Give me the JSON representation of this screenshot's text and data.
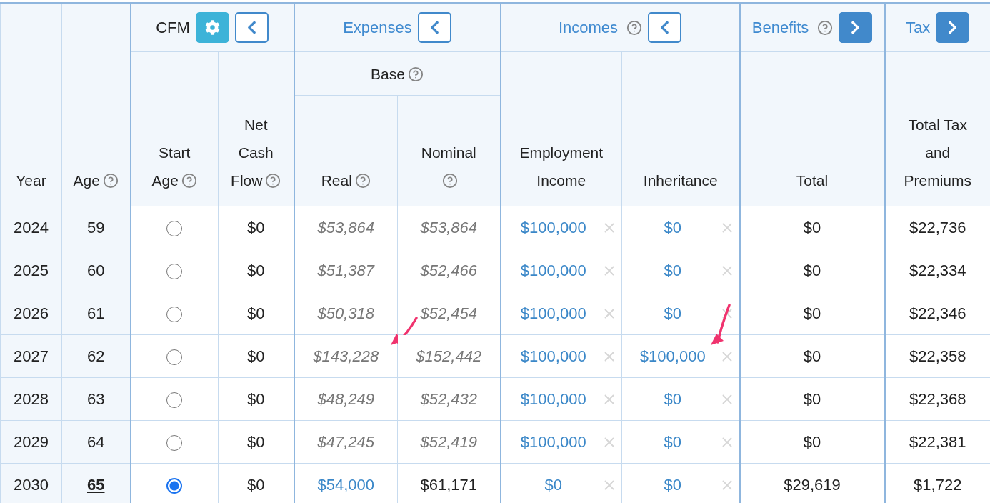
{
  "header": {
    "top": [
      {
        "label": "Year",
        "help": false,
        "link": false
      },
      {
        "label": "Age",
        "help": true,
        "link": false
      },
      {
        "label": "CFM",
        "help": false,
        "link": false,
        "buttons": [
          {
            "kind": "settings"
          },
          {
            "kind": "collapse"
          }
        ]
      },
      {
        "label": "Expenses",
        "help": false,
        "link": true,
        "buttons": [
          {
            "kind": "collapse"
          }
        ]
      },
      {
        "label": "Incomes",
        "help": true,
        "link": true,
        "buttons": [
          {
            "kind": "collapse"
          }
        ]
      },
      {
        "label": "Benefits",
        "help": true,
        "link": true,
        "buttons": [
          {
            "kind": "expand"
          }
        ]
      },
      {
        "label": "Tax",
        "help": false,
        "link": true,
        "buttons": [
          {
            "kind": "expand"
          }
        ]
      }
    ],
    "subgroup": {
      "label": "Base",
      "help": true
    },
    "columns": [
      {
        "label": "Start Age",
        "help": true
      },
      {
        "label": "Net Cash Flow",
        "help": true
      },
      {
        "label": "Real",
        "help": true
      },
      {
        "label": "Nominal",
        "help": true
      },
      {
        "label": "Employment Income",
        "help": false
      },
      {
        "label": "Inheritance",
        "help": false
      },
      {
        "label": "Total",
        "help": false
      },
      {
        "label": "Total Tax and Premiums",
        "help": false
      }
    ]
  },
  "rows": [
    {
      "year": "2024",
      "age": "59",
      "age_highlight": false,
      "start_selected": false,
      "net_cash_flow": "$0",
      "real": {
        "value": "$53,864",
        "kind": "estimate",
        "arrow": false
      },
      "nominal": {
        "value": "$53,864",
        "kind": "estimate"
      },
      "employment": {
        "value": "$100,000"
      },
      "inheritance": {
        "value": "$0",
        "arrow": false
      },
      "benefits": "$0",
      "tax": "$22,736"
    },
    {
      "year": "2025",
      "age": "60",
      "age_highlight": false,
      "start_selected": false,
      "net_cash_flow": "$0",
      "real": {
        "value": "$51,387",
        "kind": "estimate",
        "arrow": false
      },
      "nominal": {
        "value": "$52,466",
        "kind": "estimate"
      },
      "employment": {
        "value": "$100,000"
      },
      "inheritance": {
        "value": "$0",
        "arrow": false
      },
      "benefits": "$0",
      "tax": "$22,334"
    },
    {
      "year": "2026",
      "age": "61",
      "age_highlight": false,
      "start_selected": false,
      "net_cash_flow": "$0",
      "real": {
        "value": "$50,318",
        "kind": "estimate",
        "arrow": false
      },
      "nominal": {
        "value": "$52,454",
        "kind": "estimate"
      },
      "employment": {
        "value": "$100,000"
      },
      "inheritance": {
        "value": "$0",
        "arrow": false
      },
      "benefits": "$0",
      "tax": "$22,346"
    },
    {
      "year": "2027",
      "age": "62",
      "age_highlight": false,
      "start_selected": false,
      "net_cash_flow": "$0",
      "real": {
        "value": "$143,228",
        "kind": "estimate",
        "arrow": true
      },
      "nominal": {
        "value": "$152,442",
        "kind": "estimate"
      },
      "employment": {
        "value": "$100,000"
      },
      "inheritance": {
        "value": "$100,000",
        "arrow": true
      },
      "benefits": "$0",
      "tax": "$22,358"
    },
    {
      "year": "2028",
      "age": "63",
      "age_highlight": false,
      "start_selected": false,
      "net_cash_flow": "$0",
      "real": {
        "value": "$48,249",
        "kind": "estimate",
        "arrow": false
      },
      "nominal": {
        "value": "$52,432",
        "kind": "estimate"
      },
      "employment": {
        "value": "$100,000"
      },
      "inheritance": {
        "value": "$0",
        "arrow": false
      },
      "benefits": "$0",
      "tax": "$22,368"
    },
    {
      "year": "2029",
      "age": "64",
      "age_highlight": false,
      "start_selected": false,
      "net_cash_flow": "$0",
      "real": {
        "value": "$47,245",
        "kind": "estimate",
        "arrow": false
      },
      "nominal": {
        "value": "$52,419",
        "kind": "estimate"
      },
      "employment": {
        "value": "$100,000"
      },
      "inheritance": {
        "value": "$0",
        "arrow": false
      },
      "benefits": "$0",
      "tax": "$22,381"
    },
    {
      "year": "2030",
      "age": "65",
      "age_highlight": true,
      "start_selected": true,
      "net_cash_flow": "$0",
      "real": {
        "value": "$54,000",
        "kind": "set",
        "arrow": false
      },
      "nominal": {
        "value": "$61,171",
        "kind": "plain"
      },
      "employment": {
        "value": "$0"
      },
      "inheritance": {
        "value": "$0",
        "arrow": false
      },
      "benefits": "$29,619",
      "tax": "$1,722"
    }
  ]
}
